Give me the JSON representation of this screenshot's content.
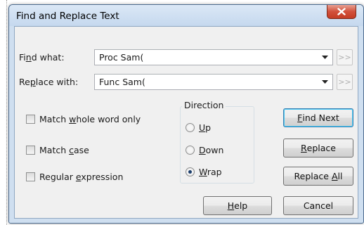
{
  "dialog": {
    "title": "Find and Replace Text"
  },
  "find": {
    "label_pre": "Fi",
    "label_key": "n",
    "label_post": "d what:",
    "value": "Proc Sam(",
    "expand_label": ">>"
  },
  "replace": {
    "label_pre": "Re",
    "label_key": "p",
    "label_post": "lace with:",
    "value": "Func Sam(",
    "expand_label": ">>"
  },
  "options": {
    "whole_word": {
      "pre": "Match ",
      "key": "w",
      "post": "hole word only",
      "checked": false
    },
    "match_case": {
      "pre": "Match ",
      "key": "c",
      "post": "ase",
      "checked": false
    },
    "regex": {
      "pre": "Regular ",
      "key": "e",
      "post": "xpression",
      "checked": false
    }
  },
  "direction": {
    "title": "Direction",
    "up": {
      "key": "U",
      "post": "p"
    },
    "down": {
      "key": "D",
      "post": "own"
    },
    "wrap": {
      "key": "W",
      "post": "rap"
    },
    "selected": "wrap"
  },
  "buttons": {
    "find_next": {
      "key": "F",
      "post": "ind Next"
    },
    "replace": {
      "key": "R",
      "post": "eplace"
    },
    "replace_all": {
      "pre": "Replace ",
      "key": "A",
      "post": "ll"
    },
    "help": {
      "key": "H",
      "post": "elp"
    },
    "cancel": "Cancel"
  },
  "colors": {
    "close_button": "#c43c24",
    "default_button_border": "#3c7fb1",
    "dialog_background": "#f0f0f0"
  },
  "icons": {
    "close": "close-icon",
    "dropdown": "chevron-down-icon"
  }
}
